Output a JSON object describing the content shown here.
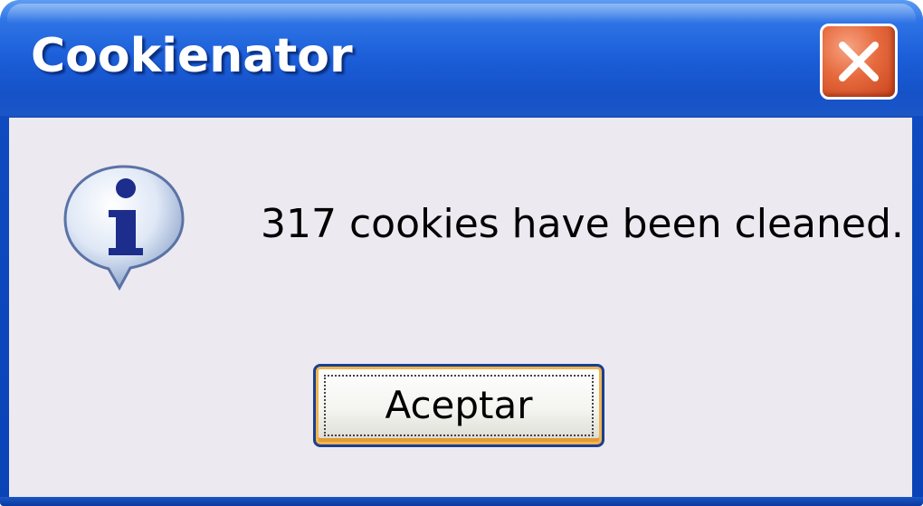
{
  "window": {
    "title": "Cookienator"
  },
  "dialog": {
    "message": "317 cookies have been cleaned.",
    "icon": "info-icon",
    "ok_label": "Aceptar"
  },
  "titlebar": {
    "close_icon": "close-icon"
  },
  "colors": {
    "titlebar_blue": "#1b5ed8",
    "close_red": "#e66a3e",
    "body_bg": "#ece9f0",
    "button_focus_orange": "#f0b450"
  }
}
